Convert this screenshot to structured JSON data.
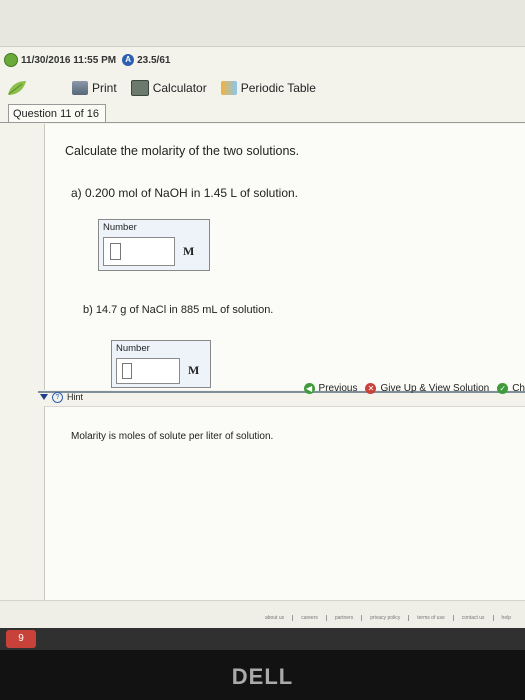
{
  "status": {
    "datetime": "11/30/2016 11:55 PM",
    "score": "23.5/61"
  },
  "toolbar": {
    "print_label": "Print",
    "calculator_label": "Calculator",
    "periodic_table_label": "Periodic Table"
  },
  "question": {
    "tab_label": "Question 11 of 16",
    "prompt": "Calculate the molarity of the two solutions.",
    "part_a": {
      "text": "a) 0.200 mol of NaOH in 1.45 L of solution.",
      "input_label": "Number",
      "value": "",
      "unit": "M"
    },
    "part_b": {
      "text": "b) 14.7 g of NaCl in 885 mL of solution.",
      "input_label": "Number",
      "value": "",
      "unit": "M"
    }
  },
  "actions": {
    "previous": "Previous",
    "give_up": "Give Up & View Solution",
    "check": "Ch"
  },
  "hint": {
    "label": "Hint",
    "text": "Molarity is moles of solute per liter of solution."
  },
  "footer": {
    "links": [
      "about us",
      "careers",
      "partners",
      "privacy policy",
      "terms of use",
      "contact us",
      "help"
    ]
  },
  "taskbar": {
    "start_label": "9"
  },
  "monitor": {
    "brand": "DELL"
  },
  "colors": {
    "score_blue": "#2d5fb0",
    "clock_green": "#6aaa3a",
    "give_up_red": "#c8423a",
    "check_green": "#3f9a3a",
    "divider": "#7f8f99"
  }
}
